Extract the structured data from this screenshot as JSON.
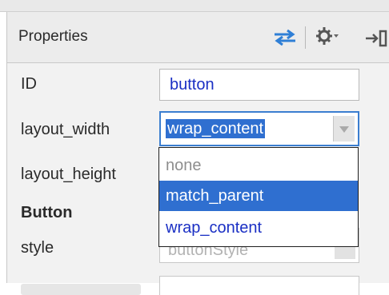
{
  "panel": {
    "title": "Properties"
  },
  "toolbar": {
    "icons": [
      "swap-arrows-icon",
      "gear-icon",
      "chevron-down-icon",
      "pin-icon"
    ],
    "accent_color": "#2f7fd6"
  },
  "properties": {
    "id_label": "ID",
    "id_value": "button",
    "layout_width_label": "layout_width",
    "layout_width_value": "wrap_content",
    "layout_height_label": "layout_height",
    "section_label": "Button",
    "style_label": "style",
    "style_value": "buttonStyle"
  },
  "dropdown": {
    "options": [
      "none",
      "match_parent",
      "wrap_content"
    ],
    "highlighted": "match_parent"
  },
  "colors": {
    "selection": "#2f6fd0",
    "value_text": "#1a2fc4"
  }
}
